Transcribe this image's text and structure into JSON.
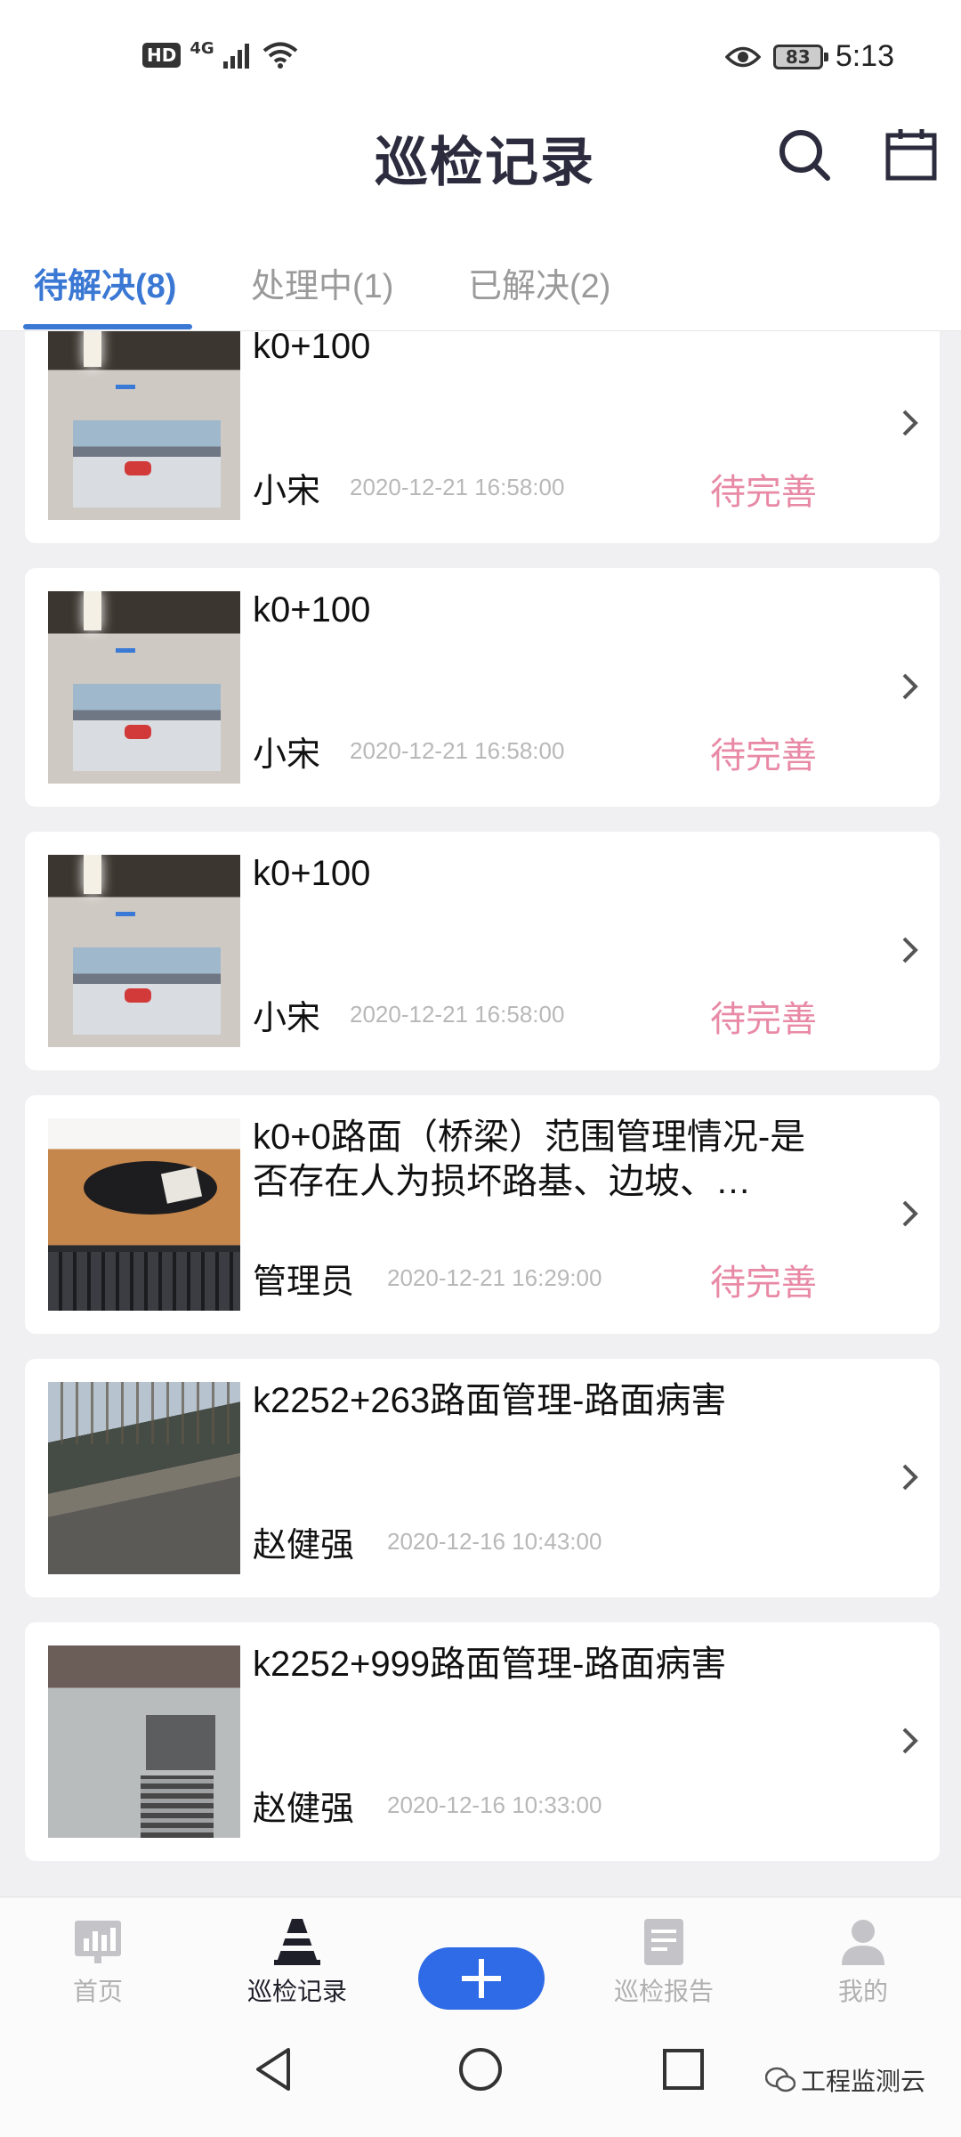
{
  "status_bar": {
    "hd": "HD",
    "network": "4G",
    "battery": "83",
    "time": "5:13"
  },
  "header": {
    "title": "巡检记录",
    "icons": [
      "search-icon",
      "calendar-icon"
    ]
  },
  "tabs": [
    {
      "label": "待解决(8)",
      "active": true
    },
    {
      "label": "处理中(1)",
      "active": false
    },
    {
      "label": "已解决(2)",
      "active": false
    }
  ],
  "records": [
    {
      "title": "k0+100",
      "user": "小宋",
      "time": "2020-12-21 16:58:00",
      "status": "待完善"
    },
    {
      "title": "k0+100",
      "user": "小宋",
      "time": "2020-12-21 16:58:00",
      "status": "待完善"
    },
    {
      "title": "k0+100",
      "user": "小宋",
      "time": "2020-12-21 16:58:00",
      "status": "待完善"
    },
    {
      "title": "k0+0路面（桥梁）范围管理情况-是否存在人为损坏路基、边坡、…",
      "user": "管理员",
      "time": "2020-12-21 16:29:00",
      "status": "待完善"
    },
    {
      "title": "k2252+263路面管理-路面病害",
      "user": "赵健强",
      "time": "2020-12-16 10:43:00",
      "status": ""
    },
    {
      "title": "k2252+999路面管理-路面病害",
      "user": "赵健强",
      "time": "2020-12-16 10:33:00",
      "status": ""
    }
  ],
  "bottom_nav": [
    {
      "label": "首页",
      "icon": "dashboard-icon",
      "active": false
    },
    {
      "label": "巡检记录",
      "icon": "traffic-cone-icon",
      "active": true
    },
    {
      "label": "巡检报告",
      "icon": "report-icon",
      "active": false
    },
    {
      "label": "我的",
      "icon": "profile-icon",
      "active": false
    }
  ],
  "watermark": "工程监测云",
  "colors": {
    "accent": "#3a78d4",
    "status_pending": "#e88aa6",
    "add_button": "#2f6be6",
    "title": "#2c2c3e"
  }
}
